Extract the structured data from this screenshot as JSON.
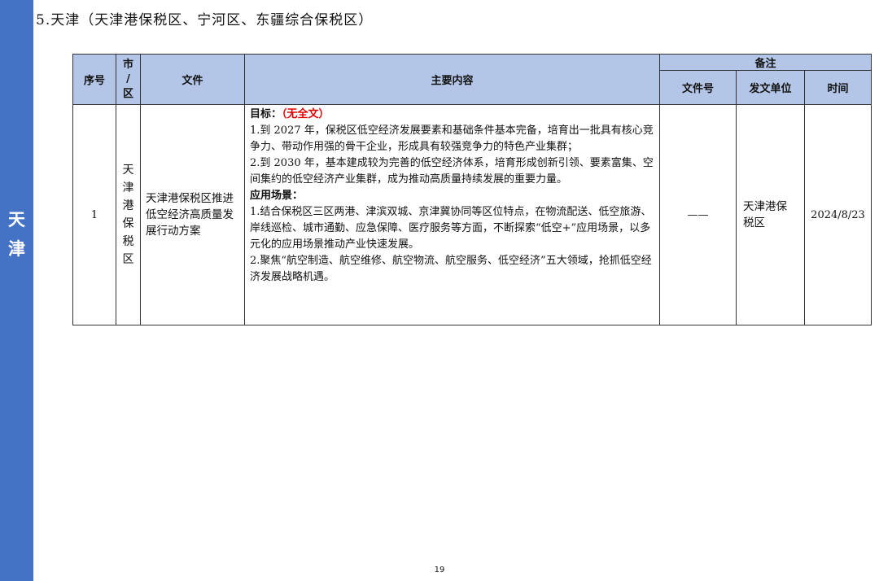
{
  "sidebar": {
    "label_line1": "天",
    "label_line2": "津"
  },
  "section_title": "5.天津（天津港保税区、宁河区、东疆综合保税区）",
  "table": {
    "headers": {
      "seq": "序号",
      "city_line1": "市",
      "city_line2": "/",
      "city_line3": "区",
      "document": "文件",
      "content": "主要内容",
      "remarks": "备注",
      "doc_number": "文件号",
      "issuer": "发文单位",
      "time": "时间"
    },
    "rows": [
      {
        "seq": "1",
        "city_chars": [
          "天",
          "津",
          "港",
          "保",
          "税",
          "区"
        ],
        "document": "天津港保税区推进低空经济高质量发展行动方案",
        "content": {
          "goal_heading": "目标：",
          "goal_note": "（无全文）",
          "goal_items": [
            "1.到 2027 年，保税区低空经济发展要素和基础条件基本完备，培育出一批具有核心竞争力、带动作用强的骨干企业，形成具有较强竞争力的特色产业集群；",
            "2.到 2030 年，基本建成较为完善的低空经济体系，培育形成创新引领、要素富集、空间集约的低空经济产业集群，成为推动高质量持续发展的重要力量。"
          ],
          "scenario_heading": "应用场景：",
          "scenario_items": [
            "1.结合保税区三区两港、津滨双城、京津冀协同等区位特点，在物流配送、低空旅游、岸线巡检、城市通勤、应急保障、医疗服务等方面，不断探索“低空+”应用场景，以多元化的应用场景推动产业快速发展。",
            "2.聚焦“航空制造、航空维修、航空物流、航空服务、低空经济”五大领域，抢抓低空经济发展战略机遇。"
          ]
        },
        "doc_number": "——",
        "issuer": "天津港保税区",
        "time": "2024/8/23"
      }
    ]
  },
  "page_number": "19",
  "colors": {
    "sidebar": "#4472c4",
    "header_fill": "#b4c6e7",
    "note_red": "#e00000"
  }
}
